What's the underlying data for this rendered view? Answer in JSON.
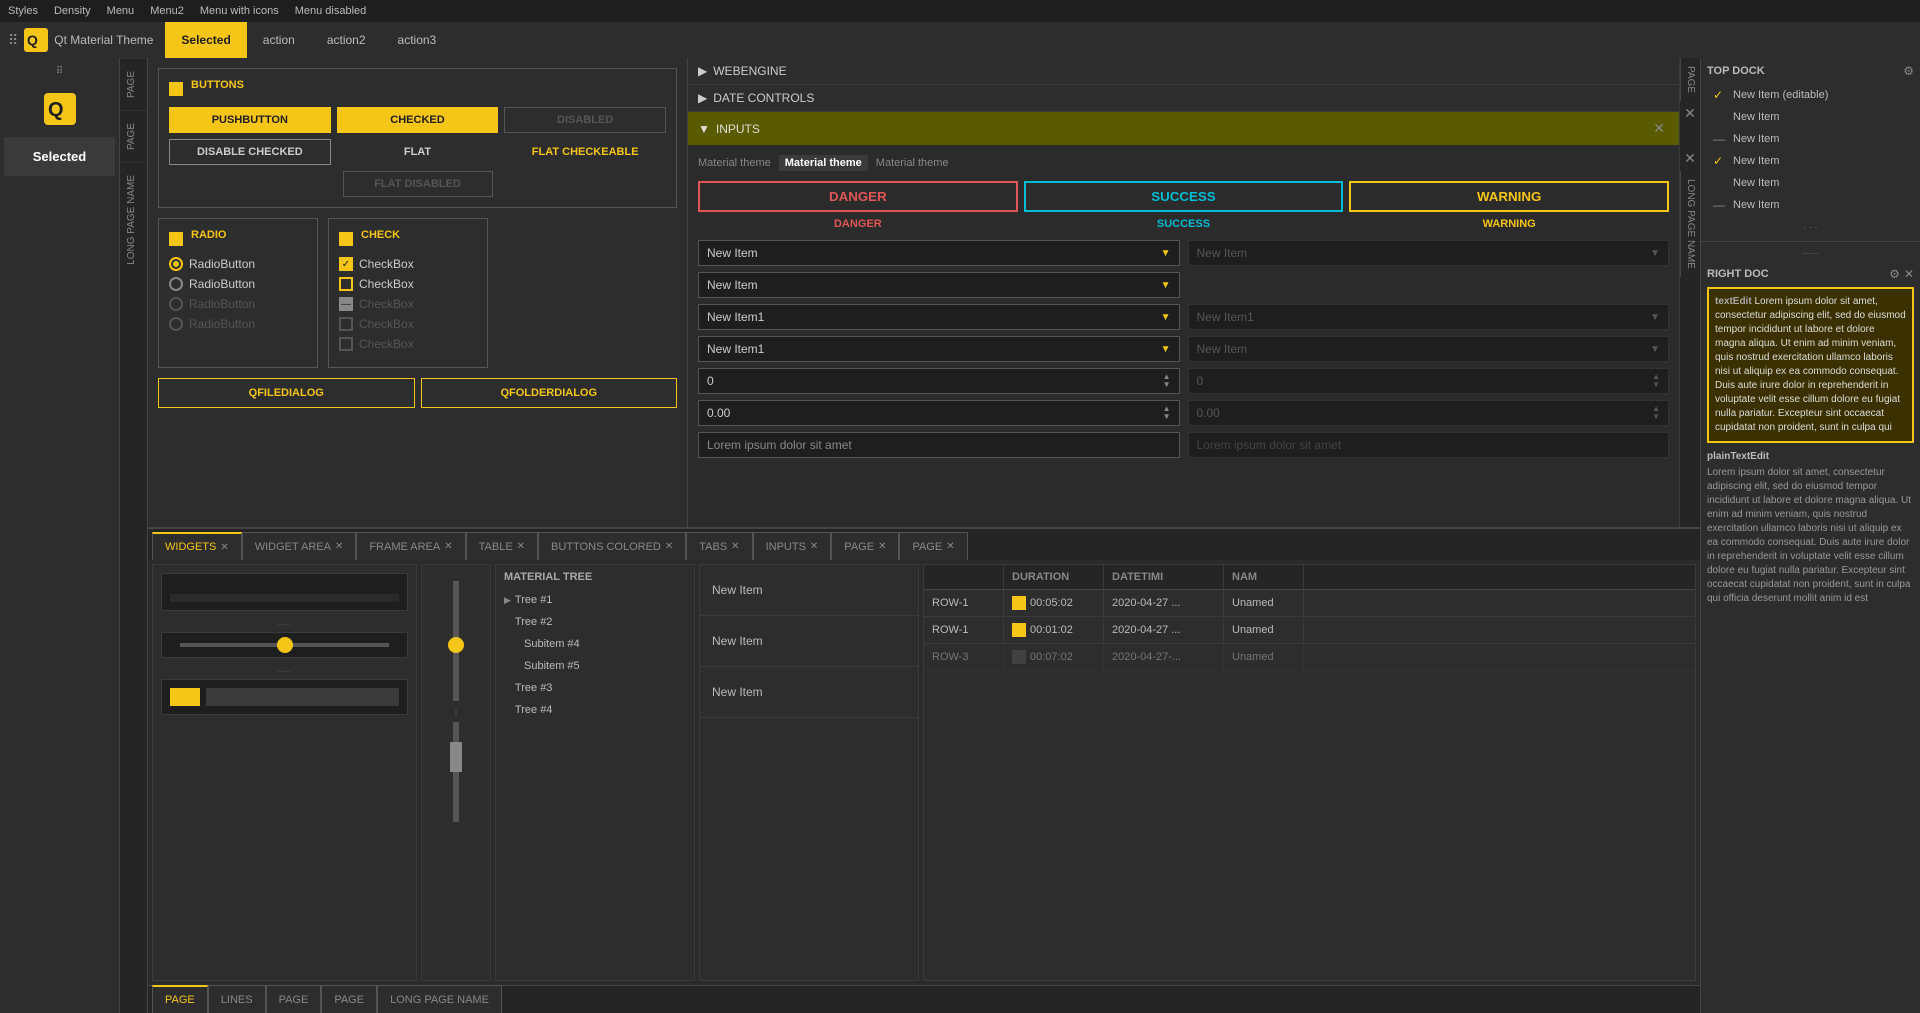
{
  "topMenu": {
    "items": [
      "Styles",
      "Density",
      "Menu",
      "Menu2",
      "Menu with icons",
      "Menu disabled"
    ]
  },
  "titleBar": {
    "appName": "Qt Material Theme",
    "tabs": [
      {
        "label": "Selected",
        "active": true
      },
      {
        "label": "action",
        "active": false
      },
      {
        "label": "action2",
        "active": false
      },
      {
        "label": "action3",
        "active": false
      }
    ]
  },
  "sidebar": {
    "selected_label": "Selected"
  },
  "pageStrips": {
    "left1": "PAGE",
    "left2": "PAGE",
    "left3": "LONG PAGE NAME",
    "right1": "PAGE",
    "right2": "LONG PAGE NAME"
  },
  "buttons": {
    "section_title": "BUTTONS",
    "pushbutton": "PUSHBUTTON",
    "checked": "CHECKED",
    "disabled": "DISABLED",
    "disable_checked": "DISABLE CHECKED",
    "flat": "FLAT",
    "flat_checkable": "FLAT CHECKEABLE",
    "flat_disabled": "FLAT DISABLED"
  },
  "radio": {
    "section_title": "RADIO",
    "items": [
      "RadioButton",
      "RadioButton",
      "RadioButton",
      "RadioButton"
    ]
  },
  "check": {
    "section_title": "CHECK",
    "items": [
      "CheckBox",
      "CheckBox",
      "CheckBox",
      "CheckBox",
      "CheckBox"
    ]
  },
  "webengine": {
    "label": "WEBENGINE"
  },
  "dateControls": {
    "label": "DATE CONTROLS"
  },
  "inputs": {
    "label": "INPUTS",
    "theme_labels": [
      "Material theme",
      "Material theme",
      "Material theme"
    ],
    "danger_label": "DANGER",
    "success_label": "SUCCESS",
    "warning_label": "WARNING",
    "flat_danger": "DANGER",
    "flat_success": "SUCCESS",
    "flat_warning": "WARNING",
    "combo1": "New Item",
    "combo2": "New Item",
    "combo1_disabled": "New Item",
    "combo3": "New Item1",
    "combo3_disabled": "New Item1",
    "combo4": "New Item1",
    "combo4_disabled": "New Item",
    "spin1": "0",
    "spin1_disabled": "0",
    "spin2": "0.00",
    "spin2_disabled": "0.00",
    "text1": "Lorem ipsum dolor sit amet",
    "text1_disabled": "Lorem ipsum dolor sit amet",
    "dialog1": "QFILEDIALOG",
    "dialog2": "QFOLDERDIALOG"
  },
  "bottomTabs": {
    "tabs": [
      {
        "label": "WIDGETS",
        "active": true,
        "closable": true
      },
      {
        "label": "WIDGET AREA",
        "active": false,
        "closable": true
      },
      {
        "label": "FRAME AREA",
        "active": false,
        "closable": true
      },
      {
        "label": "TABLE",
        "active": false,
        "closable": true
      },
      {
        "label": "BUTTONS COLORED",
        "active": false,
        "closable": true
      },
      {
        "label": "TABS",
        "active": false,
        "closable": true
      },
      {
        "label": "INPUTS",
        "active": false,
        "closable": true
      },
      {
        "label": "PAGE",
        "active": false,
        "closable": true
      },
      {
        "label": "PAGE",
        "active": false,
        "closable": true
      }
    ]
  },
  "lowerBottomTabs": {
    "tabs": [
      {
        "label": "PAGE",
        "active": true
      },
      {
        "label": "LINES",
        "active": false
      },
      {
        "label": "PAGE",
        "active": false
      },
      {
        "label": "PAGE",
        "active": false
      },
      {
        "label": "LONG PAGE NAME",
        "active": false
      }
    ]
  },
  "materialTree": {
    "header": "MATERIAL TREE",
    "items": [
      {
        "label": "Tree #1",
        "indent": 0,
        "expandable": true
      },
      {
        "label": "Tree #2",
        "indent": 0,
        "expandable": false
      },
      {
        "label": "Subitem #4",
        "indent": 1,
        "expandable": false
      },
      {
        "label": "Subitem #5",
        "indent": 1,
        "expandable": false
      },
      {
        "label": "Tree #3",
        "indent": 0,
        "expandable": false
      },
      {
        "label": "Tree #4",
        "indent": 0,
        "expandable": false
      }
    ]
  },
  "listItems": {
    "items": [
      "New Item",
      "New Item",
      "New Item"
    ]
  },
  "tableData": {
    "headers": [
      "",
      "DURATION",
      "DATETIMI",
      "NAM"
    ],
    "rows": [
      {
        "id": "ROW-1",
        "icon": "yellow",
        "duration": "00:05:02",
        "datetime": "2020-04-27 ...",
        "name": "Unamed",
        "disabled": false
      },
      {
        "id": "ROW-1",
        "icon": "yellow",
        "duration": "00:01:02",
        "datetime": "2020-04-27 ...",
        "name": "Unamed",
        "disabled": false
      },
      {
        "id": "ROW-3",
        "icon": "gray",
        "duration": "00:07:02",
        "datetime": "2020-04-27-...",
        "name": "Unamed",
        "disabled": true
      }
    ]
  },
  "topDock": {
    "title": "TOP DOCK",
    "items": [
      {
        "label": "New Item (editable)",
        "check": true,
        "dash": false
      },
      {
        "label": "New Item",
        "check": false,
        "dash": false
      },
      {
        "label": "New Item",
        "check": false,
        "dash": true
      },
      {
        "label": "New Item",
        "check": true,
        "dash": false
      },
      {
        "label": "New Item",
        "check": false,
        "dash": false
      },
      {
        "label": "New Item",
        "check": false,
        "dash": true
      }
    ]
  },
  "rightDoc": {
    "title": "RIGHT DOC",
    "textEdit_label": "textEdit",
    "textEdit_content": "Lorem ipsum dolor sit amet, consectetur adipiscing elit, sed do eiusmod tempor incididunt ut labore et dolore magna aliqua. Ut enim ad minim veniam, quis nostrud exercitation ullamco laboris nisi ut aliquip ex ea commodo consequat. Duis aute irure dolor in reprehenderit in voluptate velit esse cillum dolore eu fugiat nulla pariatur. Excepteur sint occaecat cupidatat non proident, sunt in culpa qui",
    "plainText_label": "plainTextEdit",
    "plainText_content": "Lorem ipsum dolor sit amet, consectetur adipiscing elit, sed do eiusmod tempor incididunt ut labore et dolore magna aliqua. Ut enim ad minim veniam, quis nostrud exercitation ullamco laboris nisi ut aliquip ex ea commodo consequat. Duis aute irure dolor in reprehenderit in voluptate velit esse cillum dolore eu fugiat nulla pariatur. Excepteur sint occaecat cupidatat non proident, sunt in culpa qui officia deserunt mollit anim id est"
  }
}
